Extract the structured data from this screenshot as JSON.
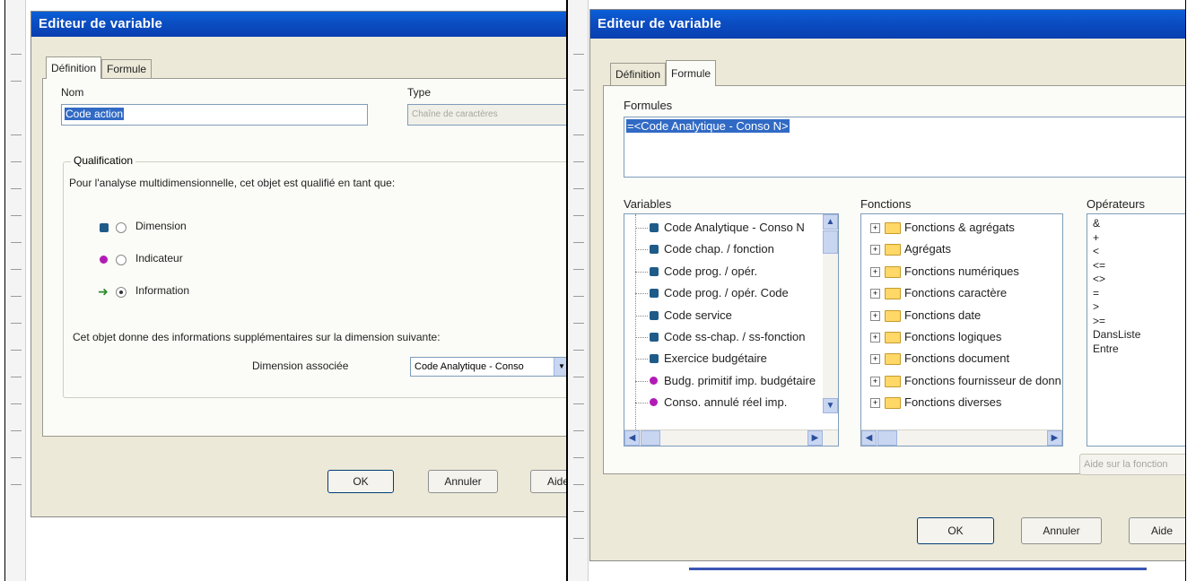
{
  "left": {
    "title": "Editeur de variable",
    "tabs": [
      "Définition",
      "Formule"
    ],
    "name_label": "Nom",
    "name_value": "Code action",
    "type_label": "Type",
    "type_value": "Chaîne de caractères",
    "qualification": {
      "legend": "Qualification",
      "description": "Pour l'analyse multidimensionnelle, cet objet est qualifié en tant que:",
      "options": [
        "Dimension",
        "Indicateur",
        "Information"
      ],
      "selected": "Information"
    },
    "info_text": "Cet objet donne des informations supplémentaires sur la dimension suivante:",
    "dim_label": "Dimension associée",
    "dim_value": "Code Analytique - Conso",
    "buttons": {
      "ok": "OK",
      "cancel": "Annuler",
      "help": "Aide"
    }
  },
  "right": {
    "title": "Editeur de variable",
    "tabs": [
      "Définition",
      "Formule"
    ],
    "formulas_label": "Formules",
    "formula_value": "=<Code Analytique - Conso N>",
    "variables_label": "Variables",
    "variables": [
      {
        "label": "Code Analytique - Conso N",
        "kind": "dimension"
      },
      {
        "label": "Code chap. / fonction",
        "kind": "dimension"
      },
      {
        "label": "Code prog. / opér.",
        "kind": "dimension"
      },
      {
        "label": "Code prog. / opér. Code",
        "kind": "dimension"
      },
      {
        "label": "Code service",
        "kind": "dimension"
      },
      {
        "label": "Code ss-chap. / ss-fonction",
        "kind": "dimension"
      },
      {
        "label": "Exercice budgétaire",
        "kind": "dimension"
      },
      {
        "label": "Budg. primitif imp. budgétaire",
        "kind": "indicator"
      },
      {
        "label": "Conso. annulé réel imp.",
        "kind": "indicator"
      }
    ],
    "functions_label": "Fonctions",
    "functions": [
      "Fonctions & agrégats",
      "Agrégats",
      "Fonctions numériques",
      "Fonctions caractère",
      "Fonctions date",
      "Fonctions logiques",
      "Fonctions document",
      "Fonctions fournisseur de données",
      "Fonctions diverses"
    ],
    "operators_label": "Opérateurs",
    "operators": [
      "&",
      "+",
      "<",
      "<=",
      "<>",
      "=",
      ">",
      ">=",
      "DansListe",
      "Entre"
    ],
    "help_function_button": "Aide sur la fonction",
    "buttons": {
      "ok": "OK",
      "cancel": "Annuler",
      "help": "Aide"
    }
  },
  "colors": {
    "titlebar": "#0b4fc4",
    "dialog_bg": "#ece9d8",
    "selection": "#316ac5",
    "dimension_icon": "#1f5b88",
    "indicator_icon": "#b21ab5",
    "information_icon": "#2a8a2a"
  },
  "icons": [
    "dimension-cube-icon",
    "indicator-dot-icon",
    "information-arrow-icon",
    "folder-icon",
    "expand-plus-icon",
    "scroll-arrow-icon",
    "dropdown-arrow-icon"
  ]
}
